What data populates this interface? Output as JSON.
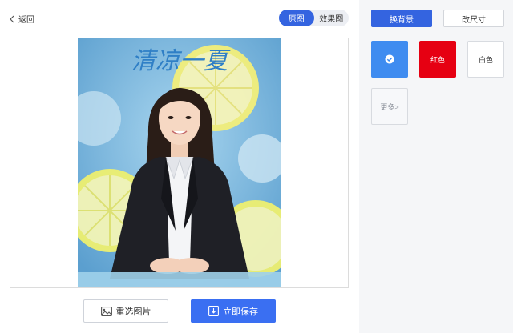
{
  "nav": {
    "back_label": "返回"
  },
  "view_toggle": {
    "original_label": "原图",
    "effect_label": "效果图",
    "active": "original"
  },
  "photo": {
    "overlay_text": "清凉一夏"
  },
  "actions": {
    "reselect_label": "重选图片",
    "save_label": "立即保存"
  },
  "side_tabs": {
    "change_bg_label": "换背景",
    "change_size_label": "改尺寸",
    "active": "change_bg"
  },
  "bg_colors": [
    {
      "name": "blue",
      "label": "",
      "color": "#3f8cf0",
      "selected": true
    },
    {
      "name": "red",
      "label": "红色",
      "color": "#e60012",
      "selected": false
    },
    {
      "name": "white",
      "label": "白色",
      "color": "#ffffff",
      "selected": false
    }
  ],
  "more_label": "更多>",
  "colors": {
    "accent": "#3464e0",
    "save": "#3a6ff2",
    "panel_bg": "#f5f6f8"
  }
}
